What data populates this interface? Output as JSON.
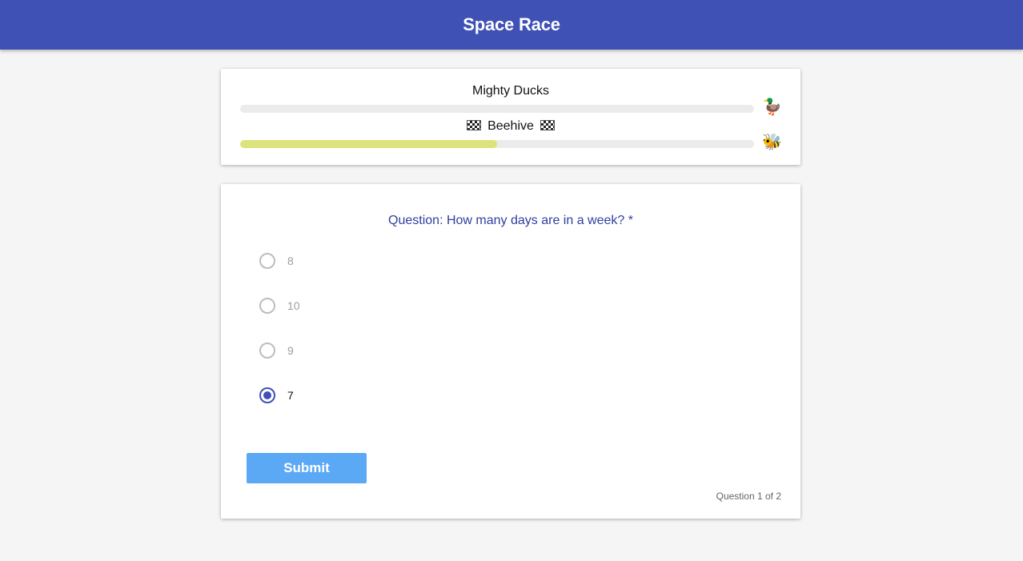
{
  "app": {
    "title": "Space Race",
    "primary_color": "#3f51b5"
  },
  "race": {
    "teams": [
      {
        "name": "Mighty Ducks",
        "has_finish_flags": false,
        "progress_fraction": 0.0,
        "mascot": "🦆",
        "mascot_icon": "duck-icon"
      },
      {
        "name": "Beehive",
        "has_finish_flags": true,
        "progress_fraction": 0.5,
        "mascot": "🐝",
        "mascot_icon": "bee-icon",
        "progress_color": "#dce37a"
      }
    ]
  },
  "quiz": {
    "question": "Question: How many days are in a week? *",
    "options": [
      {
        "label": "8",
        "selected": false
      },
      {
        "label": "10",
        "selected": false
      },
      {
        "label": "9",
        "selected": false
      },
      {
        "label": "7",
        "selected": true
      }
    ],
    "submit_label": "Submit",
    "submit_color": "#5ba8f5",
    "progress_text": "Question 1 of 2"
  }
}
